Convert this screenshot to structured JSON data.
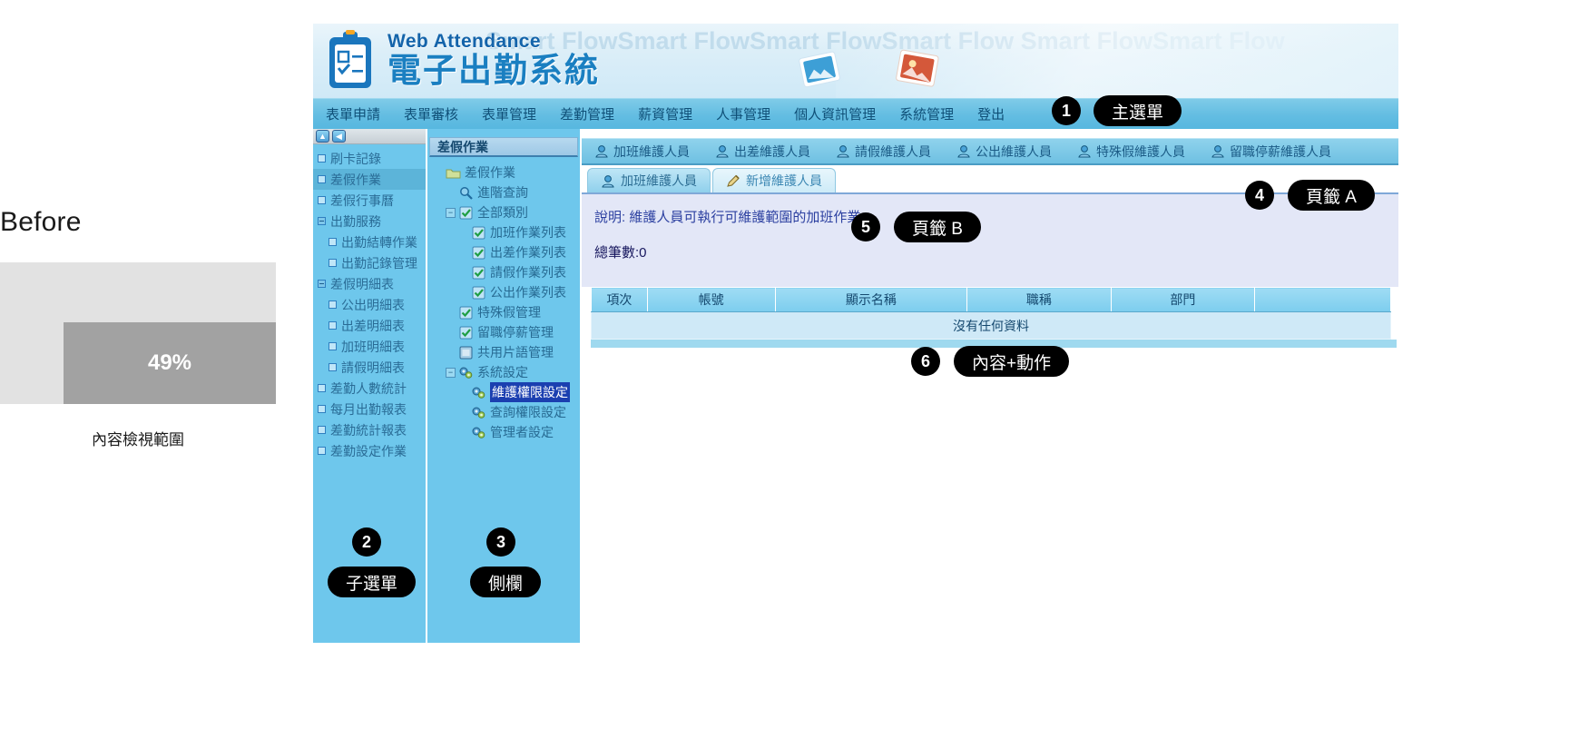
{
  "before": {
    "label": "Before",
    "percent": "49%",
    "caption": "內容檢視範圍"
  },
  "header": {
    "title_en": "Web Attendance",
    "title_zh": "電子出勤系統",
    "ghost_text": "Smart FlowSmart FlowSmart FlowSmart Flow Smart FlowSmart Flow"
  },
  "mainmenu": {
    "items": [
      "表單申請",
      "表單審核",
      "表單管理",
      "差勤管理",
      "薪資管理",
      "人事管理",
      "個人資訊管理",
      "系統管理",
      "登出"
    ]
  },
  "submenu": {
    "toolbar": [
      "up-arrow-icon",
      "back-arrow-icon"
    ],
    "items": [
      {
        "label": "刷卡記錄",
        "level": 1,
        "active": false,
        "expander": "box"
      },
      {
        "label": "差假作業",
        "level": 1,
        "active": true,
        "expander": "box"
      },
      {
        "label": "差假行事曆",
        "level": 1,
        "active": false,
        "expander": "box"
      },
      {
        "label": "出勤服務",
        "level": 1,
        "active": false,
        "expander": "minus"
      },
      {
        "label": "出勤結轉作業",
        "level": 2,
        "active": false,
        "expander": "box"
      },
      {
        "label": "出勤記錄管理",
        "level": 2,
        "active": false,
        "expander": "box"
      },
      {
        "label": "差假明細表",
        "level": 1,
        "active": false,
        "expander": "minus"
      },
      {
        "label": "公出明細表",
        "level": 2,
        "active": false,
        "expander": "box"
      },
      {
        "label": "出差明細表",
        "level": 2,
        "active": false,
        "expander": "box"
      },
      {
        "label": "加班明細表",
        "level": 2,
        "active": false,
        "expander": "box"
      },
      {
        "label": "請假明細表",
        "level": 2,
        "active": false,
        "expander": "box"
      },
      {
        "label": "差勤人數統計",
        "level": 1,
        "active": false,
        "expander": "box"
      },
      {
        "label": "每月出勤報表",
        "level": 1,
        "active": false,
        "expander": "box"
      },
      {
        "label": "差勤統計報表",
        "level": 1,
        "active": false,
        "expander": "box"
      },
      {
        "label": "差勤設定作業",
        "level": 1,
        "active": false,
        "expander": "box"
      }
    ]
  },
  "sidebar": {
    "title": "差假作業",
    "tree": [
      {
        "label": "差假作業",
        "indent": 0,
        "expander": "none",
        "icon": "folder-icon",
        "selected": false
      },
      {
        "label": "進階查詢",
        "indent": 1,
        "expander": "none",
        "icon": "search-icon",
        "selected": false
      },
      {
        "label": "全部類別",
        "indent": 1,
        "expander": "minus",
        "icon": "checklist-icon",
        "selected": false
      },
      {
        "label": "加班作業列表",
        "indent": 2,
        "expander": "none",
        "icon": "checklist-icon",
        "selected": false
      },
      {
        "label": "出差作業列表",
        "indent": 2,
        "expander": "none",
        "icon": "checklist-icon",
        "selected": false
      },
      {
        "label": "請假作業列表",
        "indent": 2,
        "expander": "none",
        "icon": "checklist-icon",
        "selected": false
      },
      {
        "label": "公出作業列表",
        "indent": 2,
        "expander": "none",
        "icon": "checklist-icon",
        "selected": false
      },
      {
        "label": "特殊假管理",
        "indent": 1,
        "expander": "none",
        "icon": "checklist-icon",
        "selected": false
      },
      {
        "label": "留職停薪管理",
        "indent": 1,
        "expander": "none",
        "icon": "checklist-icon",
        "selected": false
      },
      {
        "label": "共用片語管理",
        "indent": 1,
        "expander": "none",
        "icon": "note-icon",
        "selected": false
      },
      {
        "label": "系統設定",
        "indent": 1,
        "expander": "minus",
        "icon": "gears-icon",
        "selected": false
      },
      {
        "label": "維護權限設定",
        "indent": 2,
        "expander": "none",
        "icon": "gears-icon",
        "selected": true
      },
      {
        "label": "查詢權限設定",
        "indent": 2,
        "expander": "none",
        "icon": "gears-icon",
        "selected": false
      },
      {
        "label": "管理者設定",
        "indent": 2,
        "expander": "none",
        "icon": "gears-icon",
        "selected": false
      }
    ]
  },
  "tabs_a": [
    "加班維護人員",
    "出差維護人員",
    "請假維護人員",
    "公出維護人員",
    "特殊假維護人員",
    "留職停薪維護人員"
  ],
  "tabs_b": [
    {
      "label": "加班維護人員",
      "icon": "user-icon",
      "active": true
    },
    {
      "label": "新增維護人員",
      "icon": "pencil-icon",
      "active": false
    }
  ],
  "panel": {
    "description": "說明: 維護人員可執行可維護範圍的加班作業。",
    "total": "總筆數:0"
  },
  "table": {
    "columns": [
      "項次",
      "帳號",
      "顯示名稱",
      "職稱",
      "部門",
      ""
    ],
    "empty_text": "沒有任何資料"
  },
  "callouts": [
    {
      "num": "1",
      "label": "主選單"
    },
    {
      "num": "2",
      "label": "子選單"
    },
    {
      "num": "3",
      "label": "側欄"
    },
    {
      "num": "4",
      "label": "頁籤 A"
    },
    {
      "num": "5",
      "label": "頁籤 B"
    },
    {
      "num": "6",
      "label": "內容+動作"
    }
  ]
}
